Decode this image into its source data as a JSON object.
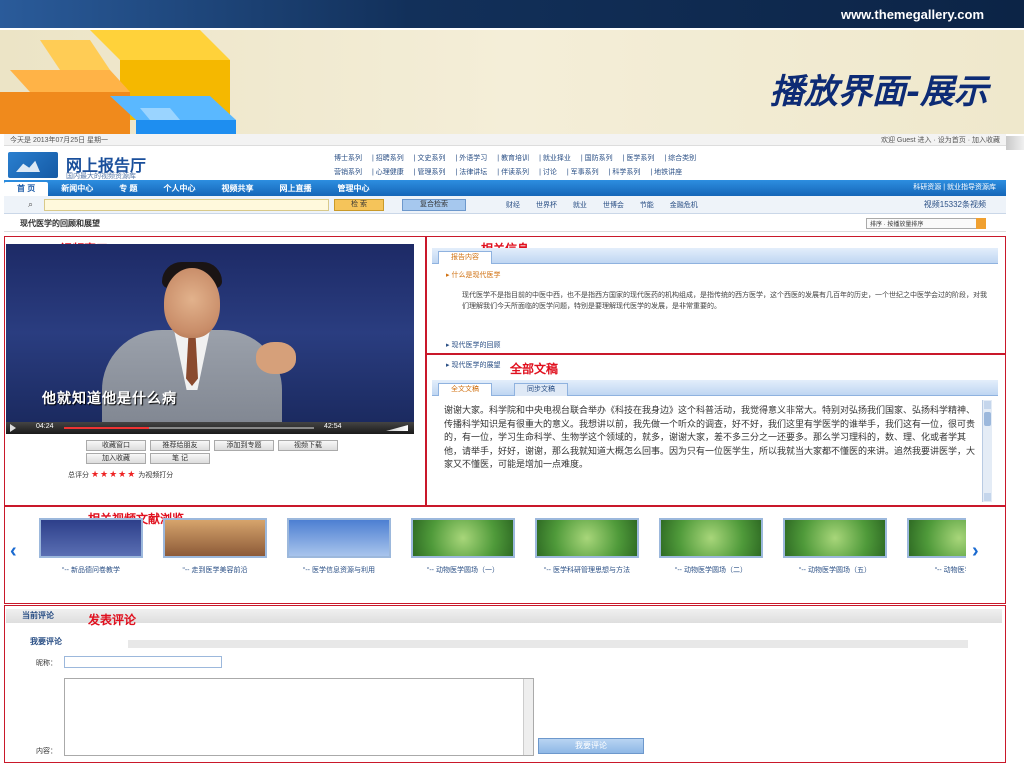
{
  "slide": {
    "url": "www.themegallery.com",
    "title": "播放界面-展示"
  },
  "site": {
    "topbar_left": "今天是 2013年07月25日 星期一",
    "topbar_right": "欢迎 Guest 进入   · 设为首页  · 加入收藏",
    "logo_name": "网上报告厅",
    "logo_sub": "国内最大的视频资源库",
    "categories_row1": [
      "博士系列",
      "招聘系列",
      "文史系列",
      "外语学习",
      "教育培训",
      "就业择业",
      "国防系列",
      "医学系列",
      "综合类别"
    ],
    "categories_row2": [
      "营销系列",
      "心理健康",
      "管理系列",
      "法律讲坛",
      "伴读系列",
      "讨论",
      "军事系列",
      "科学系列",
      "地铁讲座"
    ],
    "nav_tabs": [
      "首 页",
      "新闻中心",
      "专 题",
      "个人中心",
      "视频共享",
      "网上直播",
      "管理中心"
    ],
    "nav_right": "科研资源  |  就业指导资源库",
    "search_btn": "检 索",
    "search_btn2": "复合检索",
    "hot_words": [
      "财经",
      "世界杯",
      "就业",
      "世博会",
      "节能",
      "金融危机"
    ],
    "total_label": "视频15332条视频",
    "video_title": "现代医学的回顾和展望",
    "sort_select": "排序 · 按播放量排序"
  },
  "annotations": {
    "video_window": "视频窗口",
    "related_info": "相关信息",
    "full_text": "全部文稿",
    "related_browse": "相关视频文献浏览",
    "comment": "发表评论"
  },
  "player": {
    "subtitle": "他就知道他是什么病",
    "time_current": "04:24",
    "time_total": "42:54",
    "buttons": [
      "收藏窗口",
      "推荐给朋友",
      "添加到专题",
      "视频下载",
      "加入收藏",
      "笔 记"
    ],
    "rating_label": "总评分",
    "rating_stars": "★★★★★",
    "rating_hint": "为视频打分"
  },
  "info_panel": {
    "tab": "报告内容",
    "row1": "▸ 什么是现代医学",
    "paragraph": "现代医学不是指目前的中医中西，也不是指西方国家的现代医药的机构组成，是指传统的西方医学，这个西医的发展有几百年的历史，一个世纪之中医学会过的阶段，对我们理解我们今天所面临的医学问题，特别是要理解现代医学的发展，是非常重要的。",
    "row2": "▸ 现代医学的回顾",
    "row3": "▸ 现代医学的展望"
  },
  "fulltext_panel": {
    "tab_active": "全文文稿",
    "tab_other": "同步文稿",
    "text": "谢谢大家。科学院和中央电视台联合举办《科技在我身边》这个科普活动，我觉得意义非常大。特别对弘扬我们国家、弘扬科学精神、传播科学知识是有很重大的意义。我想讲以前，我先做一个听众的调查，好不好，我们这里有学医学的谁举手，我们这有一位，很可贵的，有一位，学习生命科学、生物学这个领域的，就多，谢谢大家，差不多三分之一还要多。那么学习理科的，数、理、化或者学其他，请举手，好好，谢谢，那么我就知道大概怎么回事。因为只有一位医学生，所以我就当大家都不懂医的来讲。追然我要讲医学，大家又不懂医，可能是增加一点难度。"
  },
  "related_videos": [
    {
      "caption": "“-- 新品德问卷教学"
    },
    {
      "caption": "“-- 走到医学美容前沿"
    },
    {
      "caption": "“-- 医学信息资源与利用"
    },
    {
      "caption": "“-- 动物医学圆场（一）"
    },
    {
      "caption": "“-- 医学科研管理思想与方法"
    },
    {
      "caption": "“-- 动物医学圆场（二）"
    },
    {
      "caption": "“-- 动物医学圆场（五）"
    },
    {
      "caption": "“-- 动物医学（E"
    }
  ],
  "comments": {
    "header": "当前评论",
    "sub_header": "我要评论",
    "nickname_label": "昵称：",
    "content_label": "内容：",
    "submit": "我要评论"
  },
  "colors": {
    "annotation_red": "#c9182a",
    "title_blue": "#0d2b75",
    "nav_blue": "#1566b8"
  }
}
